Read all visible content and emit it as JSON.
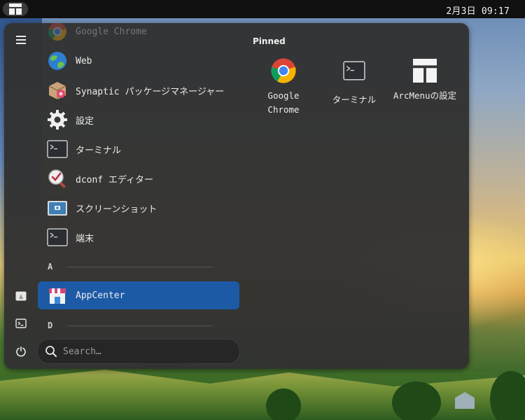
{
  "top_panel": {
    "clock": "2月3日 09:17",
    "launcher_icon": "arcmenu-icon"
  },
  "menu": {
    "left_rail": [
      {
        "name": "hamburger-menu-icon"
      },
      {
        "name": "appcenter-icon"
      },
      {
        "name": "terminal-icon"
      },
      {
        "name": "power-icon"
      }
    ],
    "apps": [
      {
        "label": "Google Chrome",
        "icon": "chrome-icon"
      },
      {
        "label": "Web",
        "icon": "web-browser-icon"
      },
      {
        "label": "Synaptic パッケージマネージャー",
        "icon": "synaptic-icon"
      },
      {
        "label": "設定",
        "icon": "settings-gear-icon"
      },
      {
        "label": "ターミナル",
        "icon": "terminal-icon"
      },
      {
        "label": "dconf エディター",
        "icon": "dconf-editor-icon"
      },
      {
        "label": "スクリーンショット",
        "icon": "screenshot-icon"
      },
      {
        "label": "端末",
        "icon": "terminal-icon"
      },
      {
        "label": "AppCenter",
        "icon": "appcenter-store-icon"
      }
    ],
    "sections": [
      "A",
      "D"
    ],
    "search_placeholder": "Search…",
    "pinned_title": "Pinned",
    "pinned": [
      {
        "label": "Google Chrome",
        "icon": "chrome-icon"
      },
      {
        "label": "ターミナル",
        "icon": "terminal-icon"
      },
      {
        "label": "ArcMenuの設定",
        "icon": "arcmenu-settings-icon"
      }
    ]
  },
  "colors": {
    "selected": "#1c5aa6",
    "menu_bg": "#323232",
    "panel_bg": "#101010"
  }
}
